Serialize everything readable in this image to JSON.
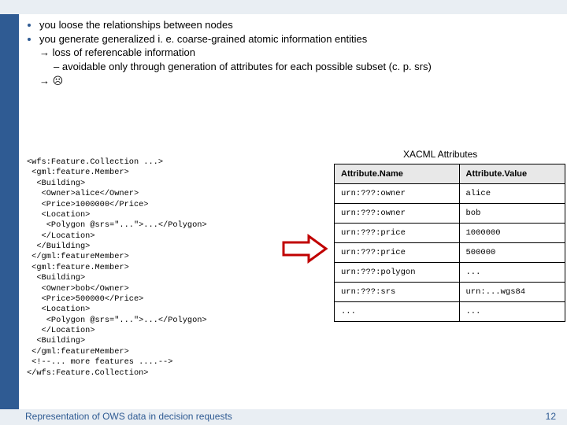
{
  "bullets": {
    "b1": "you loose the relationships between nodes",
    "b2": "you generate generalized i. e. coarse-grained  atomic information entities",
    "loss": "→ loss of referencable information",
    "dash1": "avoidable only through generation of attributes for each possible subset (c. p. srs)",
    "arrow_sad": "→ ☹"
  },
  "code_block": "<wfs:Feature.Collection ...>\n <gml:feature.Member>\n  <Building>\n   <Owner>alice</Owner>\n   <Price>1000000</Price>\n   <Location>\n    <Polygon @srs=\"...\">...</Polygon>\n   </Location>\n  </Building>\n </gml:featureMember>\n <gml:feature.Member>\n  <Building>\n   <Owner>bob</Owner>\n   <Price>500000</Price>\n   <Location>\n    <Polygon @srs=\"...\">...</Polygon>\n   </Location>\n  <Building>\n </gml:featureMember>\n <!--... more features ....-->\n</wfs:Feature.Collection>",
  "table": {
    "caption": "XACML Attributes",
    "headers": {
      "name": "Attribute.Name",
      "value": "Attribute.Value"
    },
    "rows": [
      {
        "name": "urn:???:owner",
        "value": "alice"
      },
      {
        "name": "urn:???:owner",
        "value": "bob"
      },
      {
        "name": "urn:???:price",
        "value": "1000000"
      },
      {
        "name": "urn:???:price",
        "value": "500000"
      },
      {
        "name": "urn:???:polygon",
        "value": "..."
      },
      {
        "name": "urn:???:srs",
        "value": "urn:...wgs84"
      },
      {
        "name": "...",
        "value": "..."
      }
    ]
  },
  "footer": {
    "title": "Representation of OWS data in decision requests",
    "page": "12"
  }
}
